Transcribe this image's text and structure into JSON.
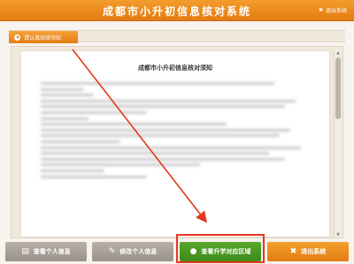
{
  "header": {
    "title": "成都市小升初信息核对系统",
    "logout_label": "退出系统"
  },
  "tabbar": {
    "active_tab": "请认真阅读须知"
  },
  "document": {
    "title": "成都市小升初信息核对须知"
  },
  "footer": {
    "buttons": [
      {
        "label": "查看个人信息"
      },
      {
        "label": "修改个人信息"
      },
      {
        "label": "查看升学对应区域"
      },
      {
        "label": "退出系统"
      }
    ]
  },
  "colors": {
    "accent": "#e47c12",
    "green": "#3d8a19",
    "highlight": "#e4381c"
  }
}
